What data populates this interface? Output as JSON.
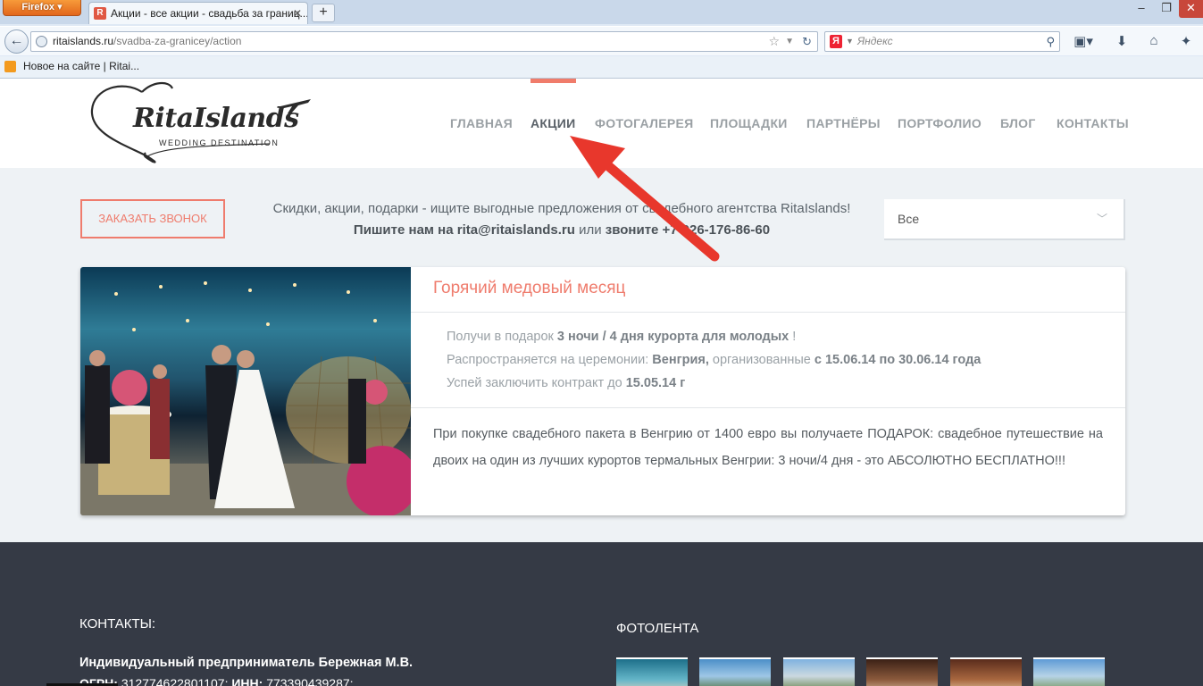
{
  "browser": {
    "app_button": "Firefox",
    "tab_title": "Акции - все акции - свадьба за границ...",
    "tab_icon": "R",
    "url_host": "ritaislands.ru",
    "url_path": "/svadba-za-granicey/action",
    "search_placeholder": "Яндекс",
    "search_engine_icon": "Я",
    "bookmark": "Новое на сайте | Ritai..."
  },
  "header": {
    "logo_text": "RitaIslands",
    "logo_sub": "WEDDING DESTINATION",
    "nav": [
      {
        "label": "ГЛАВНАЯ",
        "active": false
      },
      {
        "label": "АКЦИИ",
        "active": true
      },
      {
        "label": "ФОТОГАЛЕРЕЯ",
        "active": false
      },
      {
        "label": "ПЛОЩАДКИ",
        "active": false
      },
      {
        "label": "ПАРТНЁРЫ",
        "active": false
      },
      {
        "label": "ПОРТФОЛИО",
        "active": false
      },
      {
        "label": "БЛОГ",
        "active": false
      },
      {
        "label": "КОНТАКТЫ",
        "active": false
      }
    ]
  },
  "intro": {
    "call_button": "ЗАКАЗАТЬ ЗВОНОК",
    "line1": "Скидки, акции, подарки - ищите выгодные предложения от свадебного агентства RitaIslands!",
    "line2_a": "Пишите нам на rita@ritaislands.ru",
    "line2_b": " или ",
    "line2_c": "звоните +7-926-176-86-60",
    "filter_value": "Все"
  },
  "promo": {
    "title": "Горячий медовый месяц",
    "meta1_a": "Получи в подарок ",
    "meta1_b": "3 ночи / 4 дня курорта для молодых",
    "meta1_c": " !",
    "meta2_a": "Распространяется на церемонии: ",
    "meta2_b": "Венгрия,",
    "meta2_c": " организованные ",
    "meta2_d": "с 15.06.14 по 30.06.14 года",
    "meta3_a": "Успей заключить контракт до ",
    "meta3_b": "15.05.14 г",
    "description": "При покупке свадебного пакета в Венгрию от 1400 евро вы получаете ПОДАРОК: свадебное путешествие на двоих на один из лучших курортов термальных Венгрии: 3 ночи/4 дня - это АБСОЛЮТНО БЕСПЛАТНО!!!"
  },
  "footer": {
    "contacts_title": "КОНТАКТЫ:",
    "entity": "Индивидуальный предприниматель Бережная М.В.",
    "ogrn_label": "ОГРН:",
    "ogrn_value": " 312774622801107; ",
    "inn_label": "ИНН:",
    "inn_value": " 773390439287;",
    "photostrip_title": "ФОТОЛЕНТА"
  },
  "colors": {
    "accent": "#ef7c6d",
    "footer_bg": "#353a45",
    "annotation_arrow": "#e8372c"
  },
  "icons": [
    "back-arrow-icon",
    "globe-icon",
    "star-icon",
    "reload-icon",
    "search-icon",
    "bookmarks-icon",
    "download-icon",
    "home-icon",
    "addon-icon",
    "rss-icon",
    "chevron-down-icon",
    "airplane-icon",
    "heart-icon"
  ]
}
